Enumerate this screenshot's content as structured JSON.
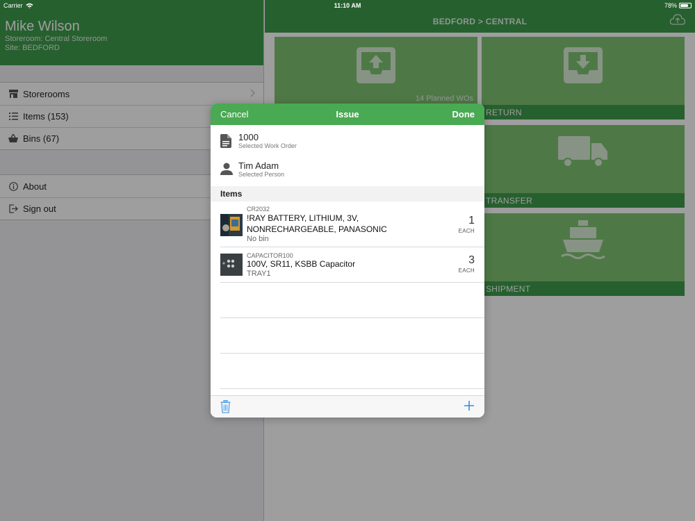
{
  "status": {
    "carrier": "Carrier",
    "time": "11:10 AM",
    "battery": "78%"
  },
  "profile": {
    "name": "Mike Wilson",
    "storeroom": "Storeroom: Central Storeroom",
    "site": "Site: BEDFORD"
  },
  "menu": {
    "main": [
      {
        "label": "Storerooms",
        "icon": "storefront-icon"
      },
      {
        "label": "Items (153)",
        "icon": "list-icon"
      },
      {
        "label": "Bins (67)",
        "icon": "basket-icon"
      }
    ],
    "secondary": [
      {
        "label": "About",
        "icon": "info-icon"
      },
      {
        "label": "Sign out",
        "icon": "sign-out-icon"
      }
    ]
  },
  "topbar": {
    "title": "BEDFORD > CENTRAL"
  },
  "tiles": {
    "issue_note": "14 Planned WOs",
    "return_label": "RETURN",
    "transfer_label": "TRANSFER",
    "shipment_label": "SHIPMENT"
  },
  "modal": {
    "cancel": "Cancel",
    "title": "Issue",
    "done": "Done",
    "work_order": {
      "value": "1000",
      "label": "Selected Work Order"
    },
    "person": {
      "value": "Tim Adam",
      "label": "Selected Person"
    },
    "section_title": "Items",
    "items": [
      {
        "code": "CR2032",
        "desc_line1": "!RAY BATTERY, LITHIUM, 3V,",
        "desc_line2": "NONRECHARGEABLE, PANASONIC",
        "bin": "No bin",
        "qty": "1",
        "unit": "EACH"
      },
      {
        "code": "CAPACITOR100",
        "desc_line1": "100V, SR11, KSBB Capacitor",
        "bin": "TRAY1",
        "qty": "3",
        "unit": "EACH"
      }
    ]
  },
  "colors": {
    "brand_green": "#3f9b4c",
    "tile_green": "#7fc371",
    "accent_blue": "#2f8ee5"
  }
}
